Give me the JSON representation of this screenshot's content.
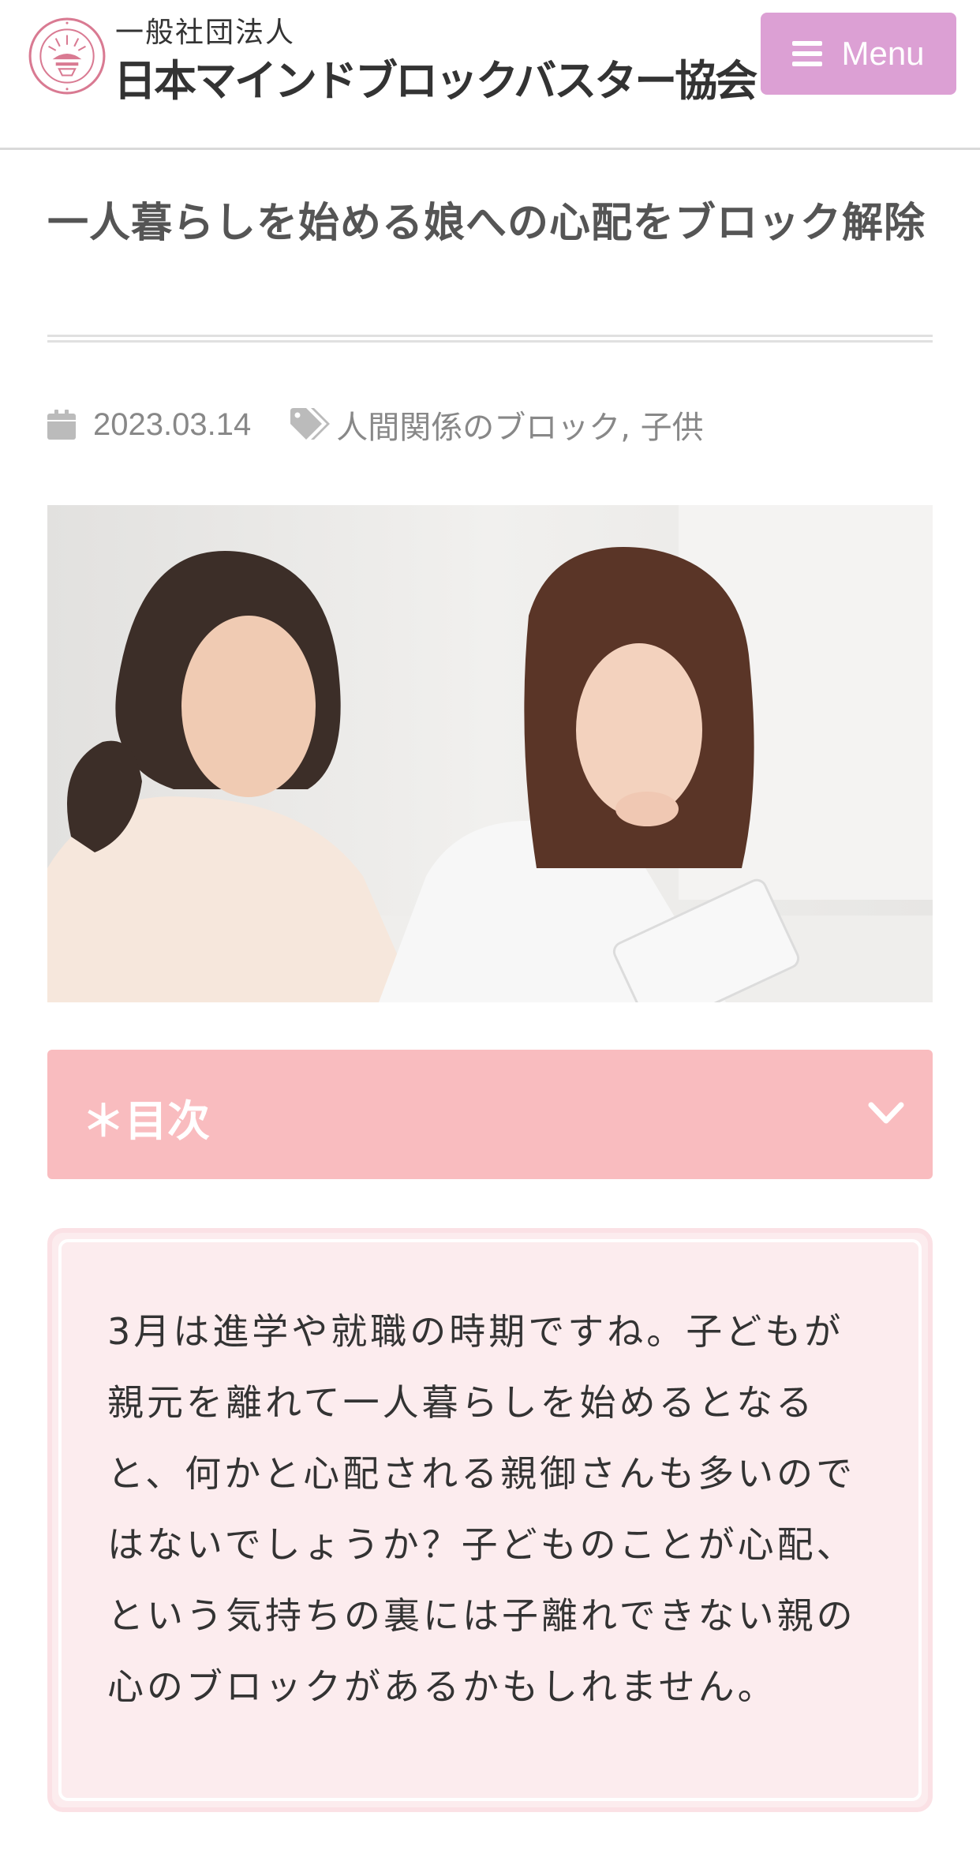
{
  "header": {
    "org_type": "一般社団法人",
    "org_name": "日本マインドブロックバスター協会",
    "menu_label": "Menu"
  },
  "article": {
    "title": "一人暮らしを始める娘への心配をブロック解除",
    "date": "2023.03.14",
    "tags": "人間関係のブロック, 子供"
  },
  "toc": {
    "label": "＊目次"
  },
  "intro": {
    "text": "3月は進学や就職の時期ですね。子どもが親元を離れて一人暮らしを始めるとなると、何かと心配される親御さんも多いのではないでしょうか？子どものことが心配、という気持ちの裏には子離れできない親の心のブロックがあるかもしれません。"
  },
  "colors": {
    "menu_button": "#dca0d4",
    "toc_bar": "#f9bcbf",
    "intro_box": "#fcecee",
    "seal": "#d97a92"
  },
  "icons": [
    "seal-logo-icon",
    "hamburger-icon",
    "calendar-icon",
    "tag-icon",
    "chevron-down-icon"
  ]
}
